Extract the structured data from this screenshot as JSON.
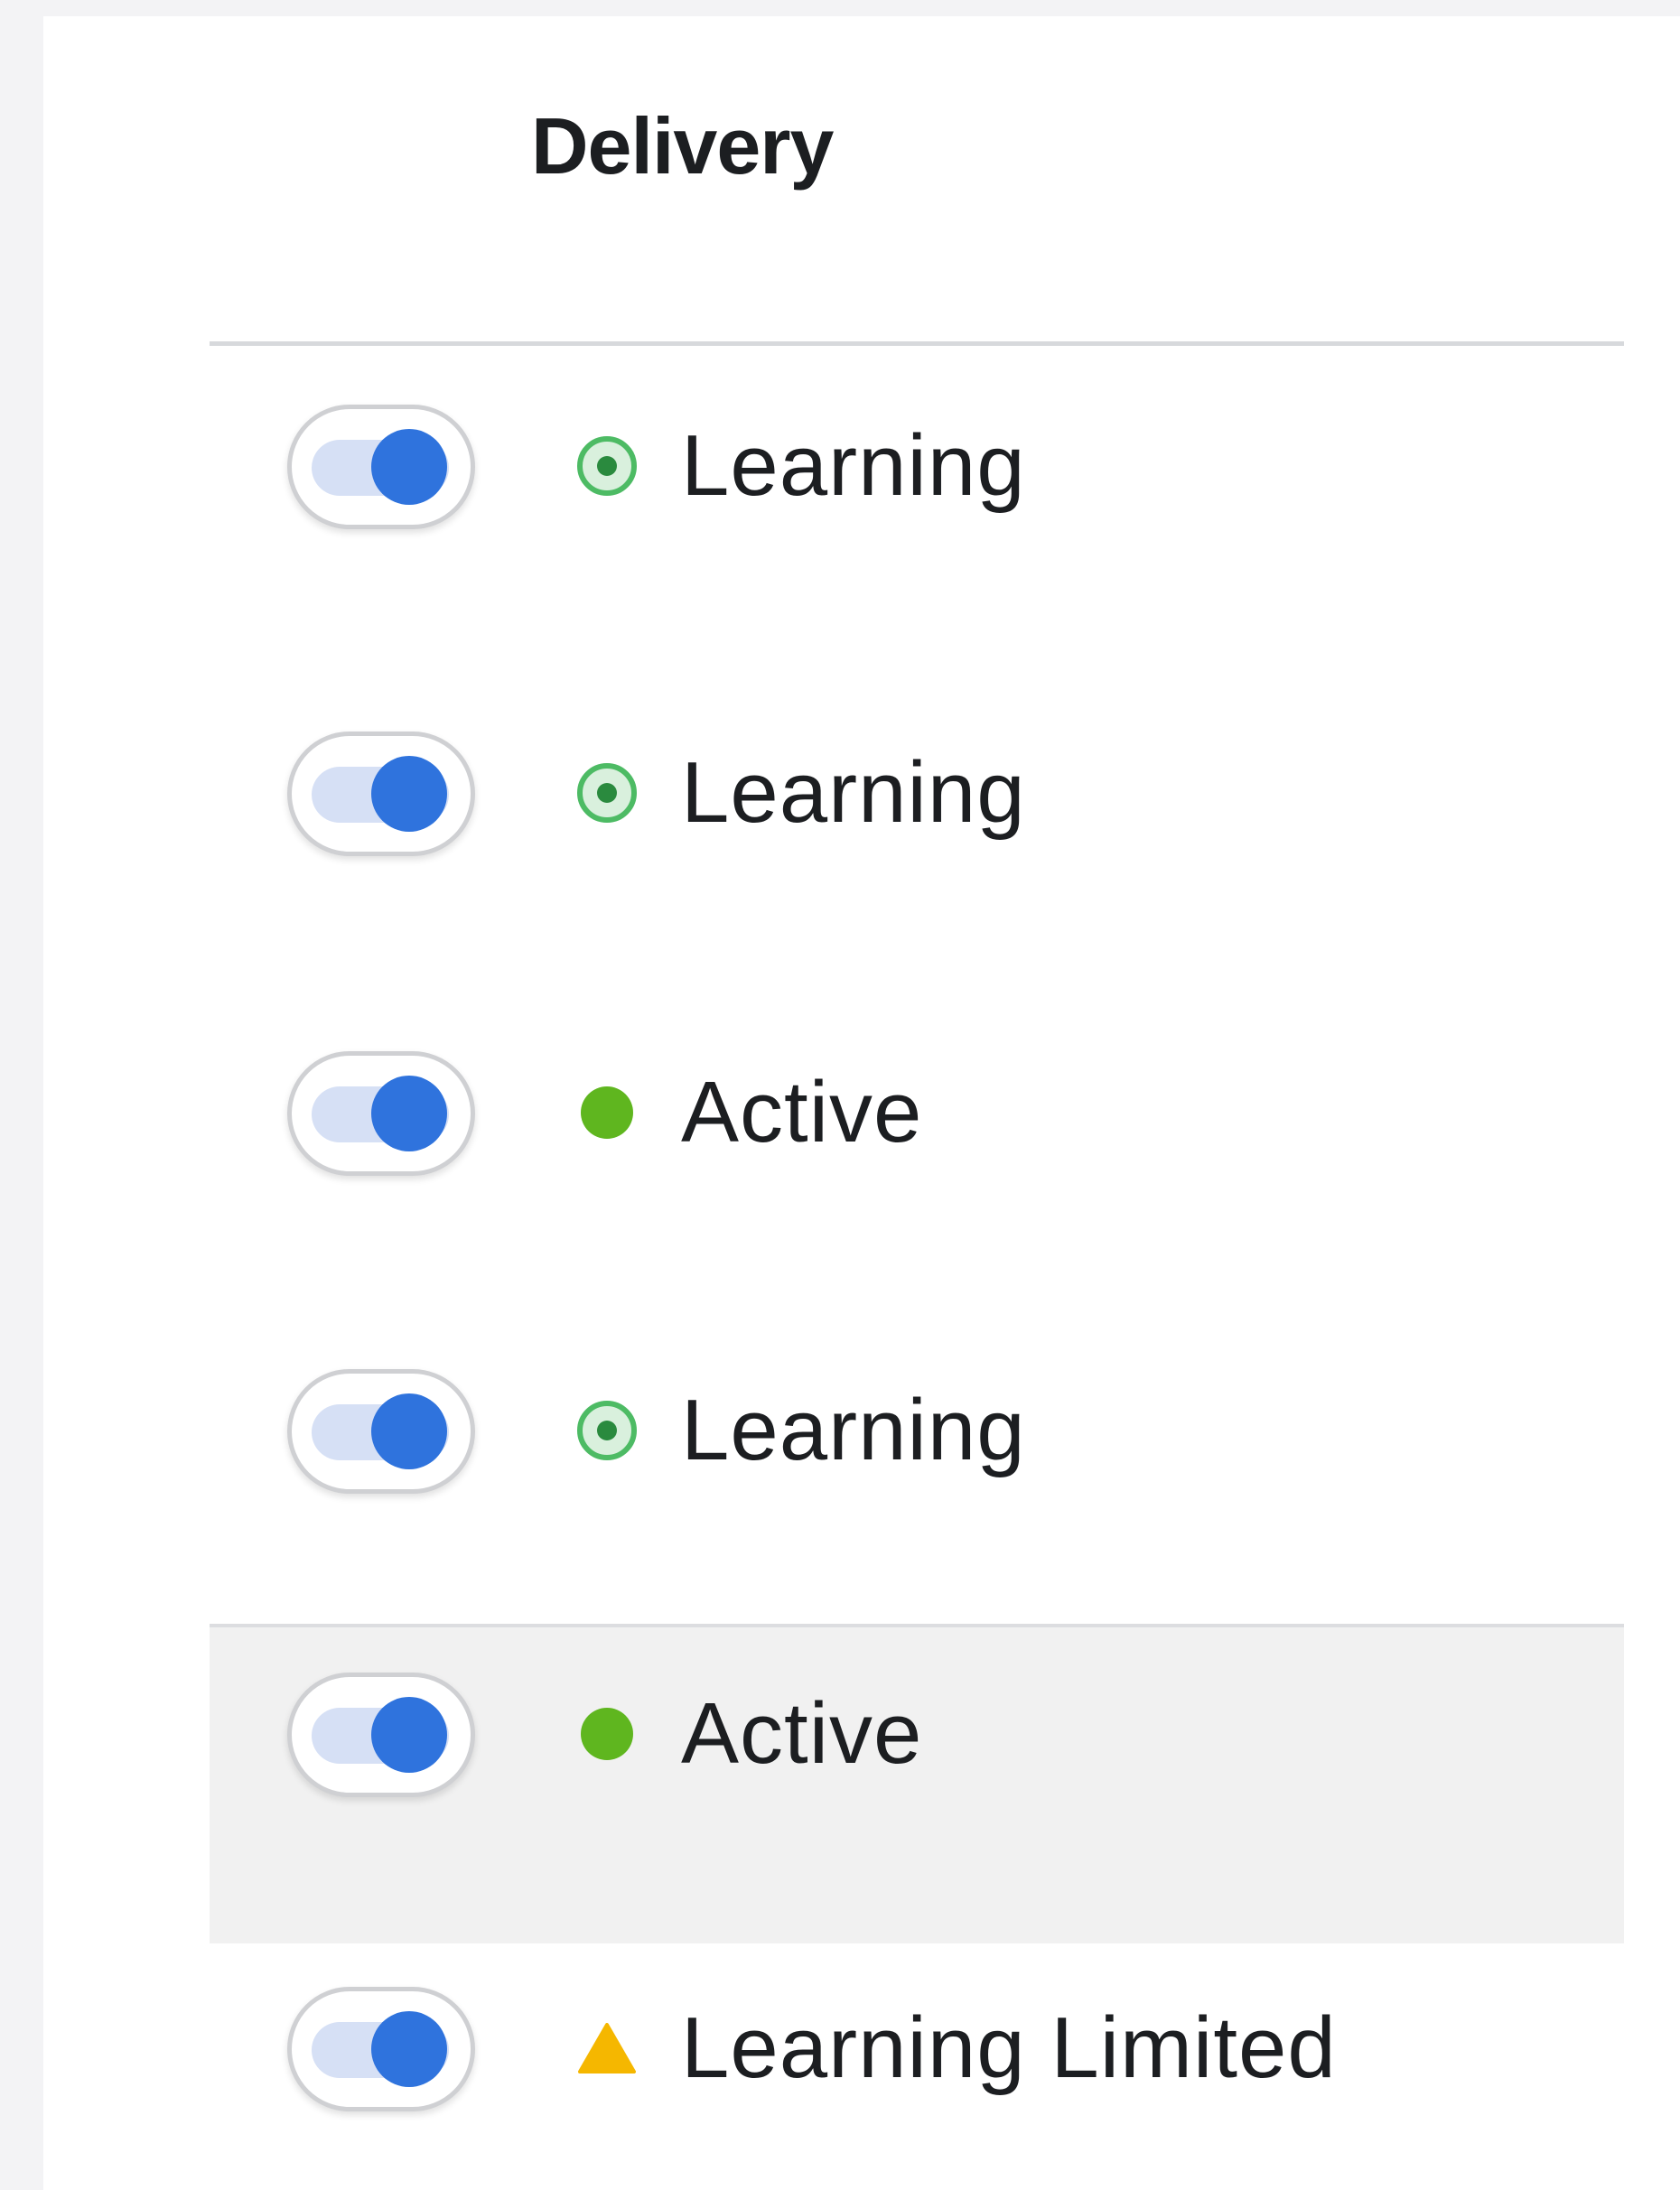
{
  "header": {
    "title": "Delivery"
  },
  "colors": {
    "toggle_on": "#2f73dd",
    "toggle_track": "#d6e0f5",
    "learning_green": "#2fa84f",
    "active_green": "#5fb61f",
    "limited_yellow": "#f5b700"
  },
  "rows": [
    {
      "toggle": "on",
      "status": "Learning",
      "icon": "learning-status-icon"
    },
    {
      "toggle": "on",
      "status": "Learning",
      "icon": "learning-status-icon"
    },
    {
      "toggle": "on",
      "status": "Active",
      "icon": "active-dot-icon"
    },
    {
      "toggle": "on",
      "status": "Learning",
      "icon": "learning-status-icon"
    },
    {
      "toggle": "on",
      "status": "Active",
      "icon": "active-dot-icon"
    },
    {
      "toggle": "on",
      "status": "Learning Limited",
      "icon": "warning-triangle-icon"
    }
  ]
}
